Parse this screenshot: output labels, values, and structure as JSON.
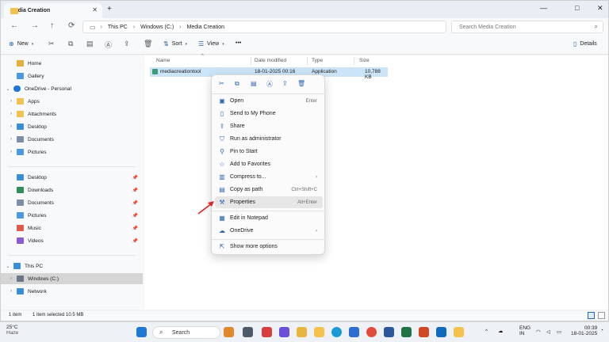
{
  "window": {
    "tab_title": "Media Creation",
    "new_tab": "+",
    "minimize": "—",
    "maximize": "□",
    "close": "✕",
    "tab_close": "✕"
  },
  "address": {
    "icon": "monitor-icon",
    "crumbs": [
      "This PC",
      "Windows (C:)",
      "Media Creation"
    ],
    "search_placeholder": "Search Media Creation"
  },
  "toolbar": {
    "new_label": "New",
    "sort_label": "Sort",
    "view_label": "View",
    "more_label": "•••",
    "details_label": "Details"
  },
  "sidebar": {
    "quick": [
      {
        "label": "Home",
        "icon": "home-icon"
      },
      {
        "label": "Gallery",
        "icon": "gallery-icon"
      }
    ],
    "onedrive": {
      "label": "OneDrive - Personal"
    },
    "onedrive_items": [
      {
        "label": "Apps"
      },
      {
        "label": "Attachments"
      },
      {
        "label": "Desktop"
      },
      {
        "label": "Documents"
      },
      {
        "label": "Pictures"
      }
    ],
    "pinned": [
      {
        "label": "Desktop"
      },
      {
        "label": "Downloads"
      },
      {
        "label": "Documents"
      },
      {
        "label": "Pictures"
      },
      {
        "label": "Music"
      },
      {
        "label": "Videos"
      }
    ],
    "this_pc": "This PC",
    "drive": "Windows (C:)",
    "network": "Network"
  },
  "columns": {
    "name": "Name",
    "date": "Date modified",
    "type": "Type",
    "size": "Size"
  },
  "file": {
    "name": "mediacreationtool",
    "date": "18-01-2025 00:16",
    "type": "Application",
    "size": "10,788 KB"
  },
  "menu": {
    "items": [
      {
        "label": "Open",
        "shortcut": "Enter",
        "icon": "open-icon"
      },
      {
        "label": "Send to My Phone",
        "shortcut": "",
        "icon": "phone-icon"
      },
      {
        "label": "Share",
        "shortcut": "",
        "icon": "share-icon"
      },
      {
        "label": "Run as administrator",
        "shortcut": "",
        "icon": "shield-icon"
      },
      {
        "label": "Pin to Start",
        "shortcut": "",
        "icon": "pin-icon"
      },
      {
        "label": "Add to Favorites",
        "shortcut": "",
        "icon": "star-icon"
      },
      {
        "label": "Compress to...",
        "shortcut": "›",
        "icon": "zip-icon"
      },
      {
        "label": "Copy as path",
        "shortcut": "Ctrl+Shift+C",
        "icon": "path-icon"
      },
      {
        "label": "Properties",
        "shortcut": "Alt+Enter",
        "icon": "wrench-icon"
      },
      {
        "label": "Edit in Notepad",
        "shortcut": "",
        "icon": "notepad-icon"
      },
      {
        "label": "OneDrive",
        "shortcut": "›",
        "icon": "cloud-icon"
      },
      {
        "label": "Show more options",
        "shortcut": "",
        "icon": "more-options-icon"
      }
    ]
  },
  "status": {
    "count": "1 item",
    "selected": "1 item selected  10.5 MB"
  },
  "taskbar": {
    "temp": "25°C",
    "condition": "Haze",
    "search": "Search",
    "lang1": "ENG",
    "lang2": "IN",
    "time": "00:39",
    "date": "18-01-2025"
  },
  "colors": {
    "accent": "#2a65b6",
    "selection": "#cce4f7",
    "arrow": "#d8262b"
  }
}
